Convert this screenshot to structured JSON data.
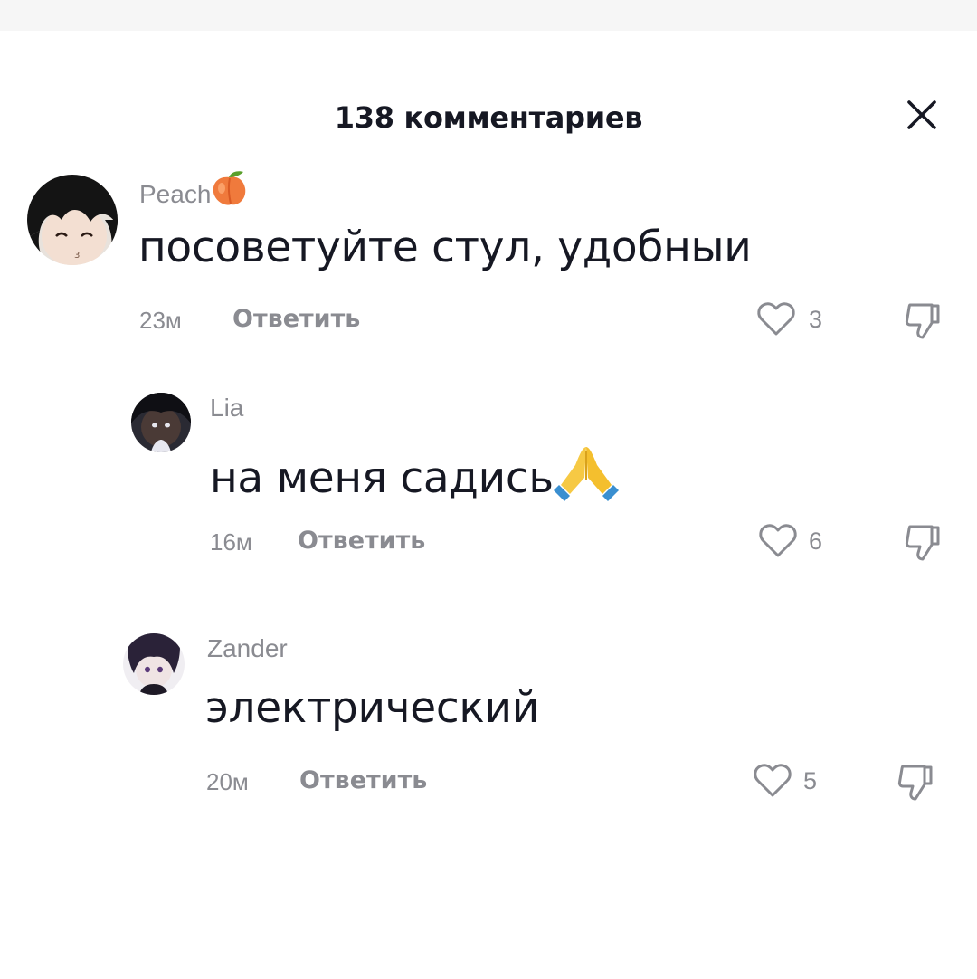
{
  "header": {
    "title": "138 комментариев",
    "close_icon": "close-icon"
  },
  "comments": [
    {
      "username": "Peach",
      "username_emoji": "peach-emoji",
      "text": "посоветуйте стул, удобныи",
      "time": "23м",
      "reply_label": "Ответить",
      "likes": "3",
      "is_reply": false
    },
    {
      "username": "Lia",
      "text": "на меня садись",
      "text_emoji": "folded-hands-emoji",
      "time": "16м",
      "reply_label": "Ответить",
      "likes": "6",
      "is_reply": true
    },
    {
      "username": "Zander",
      "text": "электрический",
      "time": "20м",
      "reply_label": "Ответить",
      "likes": "5",
      "is_reply": true
    }
  ],
  "icons": {
    "like": "heart-outline-icon",
    "dislike": "thumbs-down-outline-icon"
  },
  "colors": {
    "text_primary": "#161823",
    "text_secondary": "#8a8b91",
    "background": "#ffffff"
  }
}
